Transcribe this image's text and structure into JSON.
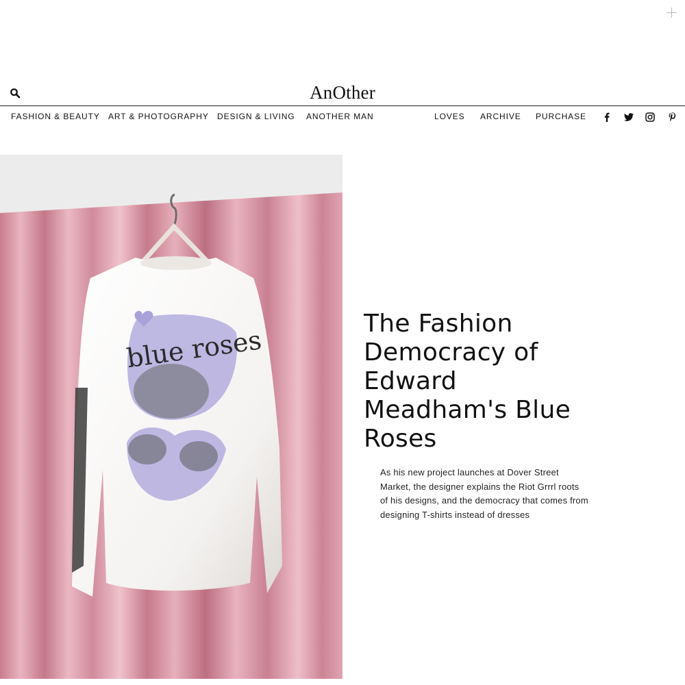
{
  "header": {
    "logo": "AnOther",
    "search_icon": "search-icon",
    "plus_icon": "plus-icon"
  },
  "nav": {
    "left": [
      "FASHION & BEAUTY",
      "ART & PHOTOGRAPHY",
      "DESIGN & LIVING",
      "ANOTHER MAN"
    ],
    "right": [
      "LOVES",
      "ARCHIVE",
      "PURCHASE"
    ],
    "social_icons": [
      "facebook-icon",
      "twitter-icon",
      "instagram-icon",
      "pinterest-icon"
    ]
  },
  "article": {
    "title": "The Fashion Democracy of Edward Meadham's Blue Roses",
    "standfirst": "As his new project launches at Dover Street Market, the designer explains the Riot Grrrl roots of his designs, and the democracy that comes from designing T-shirts instead of dresses",
    "hero_print_text": "blue roses"
  },
  "colors": {
    "curtain": "#d99aa8",
    "print_lilac": "#a9a2da",
    "rule": "#222222"
  }
}
